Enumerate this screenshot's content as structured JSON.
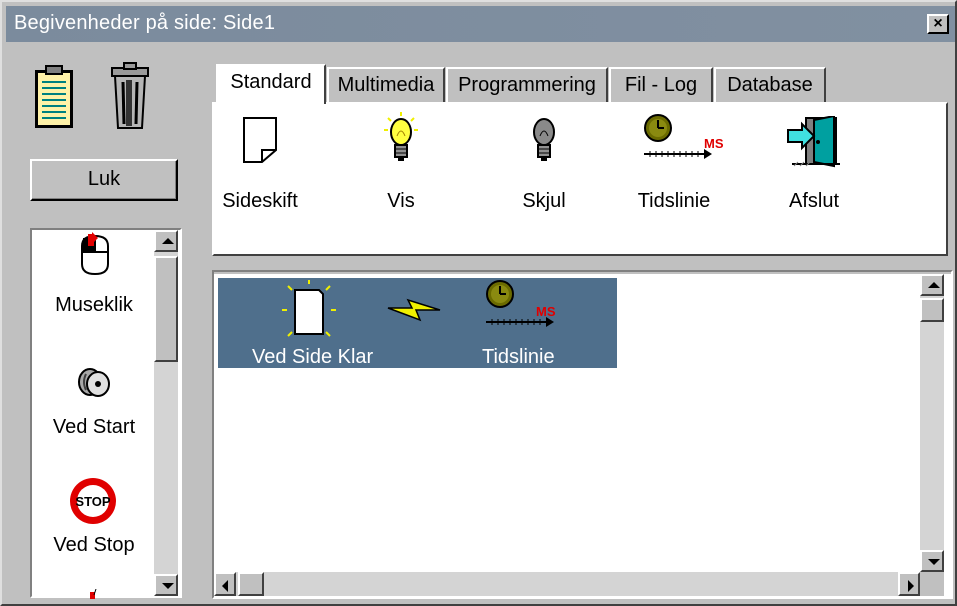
{
  "window": {
    "title": "Begivenheder på side: Side1",
    "close_glyph": "×"
  },
  "toolbar_icons": [
    {
      "name": "clipboard-icon"
    },
    {
      "name": "trash-icon"
    }
  ],
  "close_button": {
    "label": "Luk"
  },
  "events_list": {
    "items": [
      {
        "label": "Museklik",
        "icon": "mouse-click-icon"
      },
      {
        "label": "Ved Start",
        "icon": "key-start-icon"
      },
      {
        "label": "Ved Stop",
        "icon": "stop-sign-icon"
      }
    ]
  },
  "tabs": [
    {
      "label": "Standard",
      "active": true
    },
    {
      "label": "Multimedia",
      "active": false
    },
    {
      "label": "Programmering",
      "active": false
    },
    {
      "label": "Fil - Log",
      "active": false
    },
    {
      "label": "Database",
      "active": false
    }
  ],
  "tools": [
    {
      "label": "Sideskift",
      "icon": "page-icon"
    },
    {
      "label": "Vis",
      "icon": "lightbulb-on-icon"
    },
    {
      "label": "Skjul",
      "icon": "lightbulb-off-icon"
    },
    {
      "label": "Tidslinie",
      "icon": "timeline-icon",
      "badge": "MS"
    },
    {
      "label": "Afslut",
      "icon": "exit-door-icon"
    }
  ],
  "sequence": {
    "trigger_label": "Ved Side Klar",
    "action_label": "Tidslinie",
    "action_badge": "MS"
  },
  "colors": {
    "title_bar": "#7b8b9d",
    "sequence_bg": "#4f6f8c",
    "face": "#c0c0c0"
  }
}
